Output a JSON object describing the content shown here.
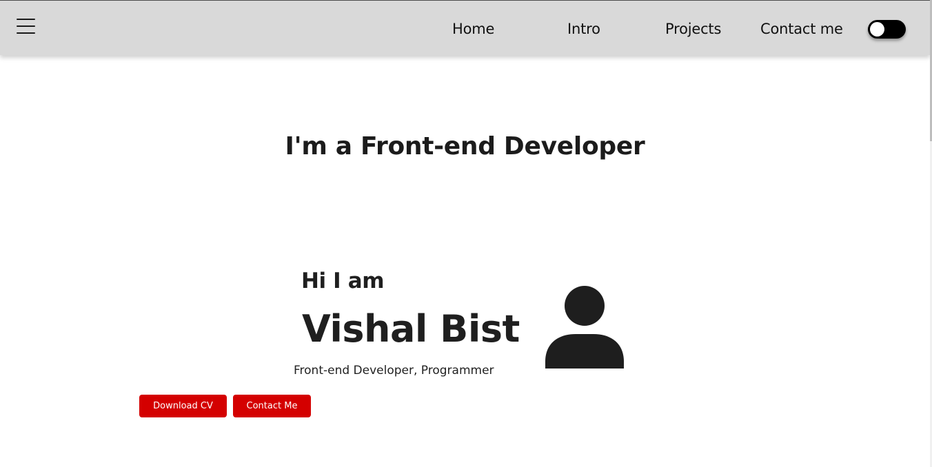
{
  "nav": {
    "menu_icon": "hamburger-menu-icon",
    "links": [
      {
        "label": "Home"
      },
      {
        "label": "Intro"
      },
      {
        "label": "Projects"
      },
      {
        "label": "Contact me"
      }
    ],
    "theme_toggle": {
      "state": "off",
      "track_color": "#000000",
      "knob_color": "#ffffff"
    },
    "background_color": "#d9d9d9"
  },
  "hero": {
    "headline": "I'm a Front-end Developer",
    "greeting": "Hi I am",
    "name": "Vishal Bist",
    "roles": "Front-end Developer, Programmer",
    "avatar_icon": "user-avatar-icon",
    "buttons": {
      "download_cv": "Download CV",
      "contact": "Contact Me"
    },
    "button_color": "#d40000"
  }
}
